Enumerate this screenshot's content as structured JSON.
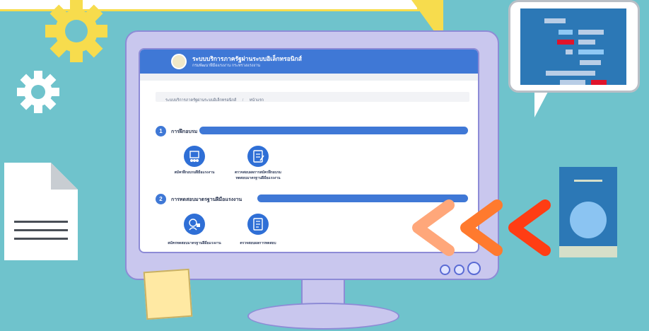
{
  "screen": {
    "title": "ระบบบริการภาครัฐผ่านระบบอิเล็กทรอนิกส์",
    "subtitle": "กรมพัฒนาฝีมือแรงงาน กระทรวงแรงงาน",
    "breadcrumb": [
      "ระบบบริการภาครัฐผ่านระบบอิเล็กทรอนิกส์",
      "หน้าแรก"
    ],
    "breadcrumb_separator": "/",
    "sections": [
      {
        "number": "1",
        "title": "การฝึกอบรม",
        "items": [
          {
            "label": "สมัครฝึกอบรมฝีมือแรงงาน",
            "icon": "training-icon"
          },
          {
            "label": "ตรวจสอบผลการสมัครฝึกอบรม\nทดสอบมาตรฐานฝีมือแรงงาน",
            "icon": "checklist-icon"
          }
        ]
      },
      {
        "number": "2",
        "title": "การทดสอบมาตรฐานฝีมือแรงงาน",
        "items": [
          {
            "label": "สมัครทดสอบมาตรฐานฝีมือแรงงาน",
            "icon": "test-apply-icon"
          },
          {
            "label": "ตรวจสอบผลการทดสอบ",
            "icon": "result-check-icon"
          }
        ]
      }
    ]
  },
  "colors": {
    "background": "#6fc3cc",
    "monitor": "#c9c7ee",
    "accent_blue": "#3f78d6",
    "gear_yellow": "#f7dc4d",
    "chevron_light": "#ffa77a",
    "chevron_mid": "#ff7a2e",
    "chevron_dark": "#ff3d14"
  }
}
